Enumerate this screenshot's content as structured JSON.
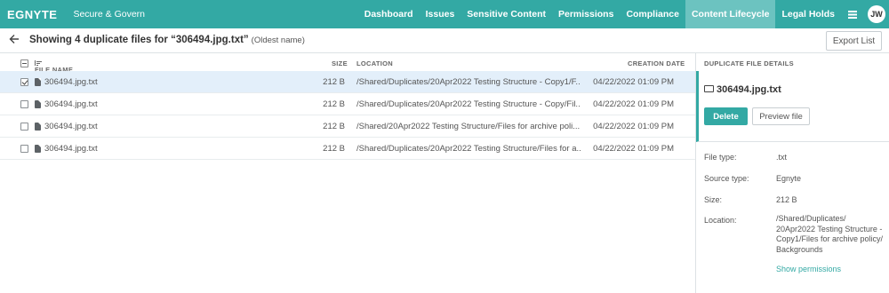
{
  "topbar": {
    "logo": "EGNYTE",
    "subtitle": "Secure & Govern",
    "nav": [
      "Dashboard",
      "Issues",
      "Sensitive Content",
      "Permissions",
      "Compliance",
      "Content Lifecycle",
      "Legal Holds"
    ],
    "active_nav": "Content Lifecycle",
    "menu_icon": "list-icon",
    "avatar": "JW",
    "color": "#33a9a4"
  },
  "header": {
    "title": "Showing 4 duplicate files for “306494.jpg.txt”",
    "subtitle": "(Oldest name)",
    "export_label": "Export List",
    "back_icon": "arrow-left-icon"
  },
  "table": {
    "columns": [
      "FILE NAME",
      "SIZE",
      "LOCATION",
      "CREATION DATE"
    ],
    "rows": [
      {
        "name": "306494.jpg.txt",
        "size": "212 B",
        "location": "/Shared/Duplicates/20Apr2022 Testing Structure - Copy1/F...",
        "date": "04/22/2022 01:09 PM",
        "selected": true
      },
      {
        "name": "306494.jpg.txt",
        "size": "212 B",
        "location": "/Shared/Duplicates/20Apr2022 Testing Structure - Copy/Fil...",
        "date": "04/22/2022 01:09 PM",
        "selected": false
      },
      {
        "name": "306494.jpg.txt",
        "size": "212 B",
        "location": "/Shared/20Apr2022 Testing Structure/Files for archive poli...",
        "date": "04/22/2022 01:09 PM",
        "selected": false
      },
      {
        "name": "306494.jpg.txt",
        "size": "212 B",
        "location": "/Shared/Duplicates/20Apr2022 Testing Structure/Files for a...",
        "date": "04/22/2022 01:09 PM",
        "selected": false
      }
    ]
  },
  "details": {
    "heading": "DUPLICATE FILE DETAILS",
    "file_name": "306494.jpg.txt",
    "delete_label": "Delete",
    "preview_label": "Preview file",
    "file_type_label": "File type:",
    "file_type": ".txt",
    "source_type_label": "Source type:",
    "source_type": "Egnyte",
    "size_label": "Size:",
    "size": "212 B",
    "location_label": "Location:",
    "location": "/Shared/Duplicates/ 20Apr2022 Testing Structure - Copy1/Files for archive policy/ Backgrounds",
    "permissions_link": "Show permissions"
  }
}
